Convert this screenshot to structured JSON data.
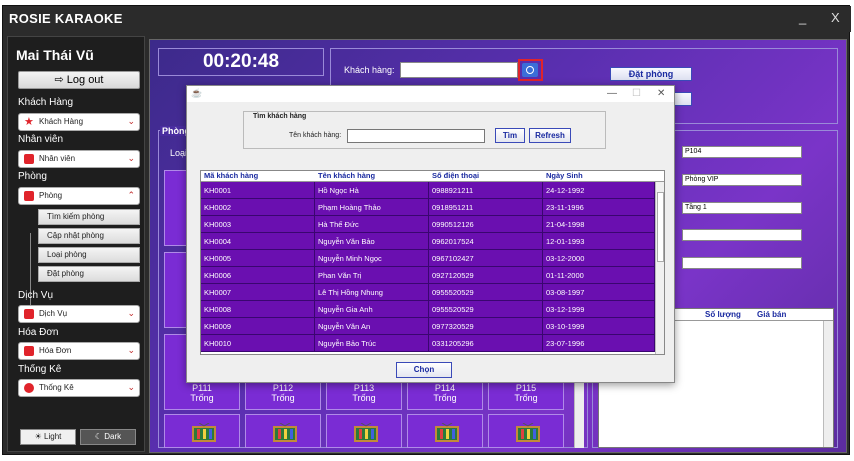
{
  "app": {
    "title": "ROSIE KARAOKE",
    "minimize": "_",
    "close": "X"
  },
  "sidebar": {
    "user_name": "Mai Thái Vũ",
    "logout": "Log out",
    "sections": [
      {
        "label": "Khách Hàng",
        "combo": "Khách Hàng"
      },
      {
        "label": "Nhân viên",
        "combo": "Nhân viên"
      },
      {
        "label": "Phòng",
        "combo": "Phòng"
      },
      {
        "label": "Dịch Vụ",
        "combo": "Dịch Vụ"
      },
      {
        "label": "Hóa Đơn",
        "combo": "Hóa Đơn"
      },
      {
        "label": "Thống Kê",
        "combo": "Thống Kê"
      }
    ],
    "phong_sub": [
      "Tìm kiếm phòng",
      "Cập nhật phòng",
      "Loại phòng",
      "Đặt phòng"
    ],
    "theme_light": "Light",
    "theme_dark": "Dark"
  },
  "main": {
    "clock": "00:20:48",
    "khach_hang_label": "Khách hàng:",
    "dat_phong": "Đặt phòng",
    "phong_label": "Phòng",
    "loai_label": "Loại",
    "room_info": {
      "so_phong": "P104",
      "loai": "Phòng VIP",
      "tang": "Tầng 1"
    },
    "service_headers": {
      "so_luong": "Số lượng",
      "gia_ban": "Giá bán"
    },
    "rooms": [
      {
        "name": "P111",
        "status": "Trống"
      },
      {
        "name": "P112",
        "status": "Trống"
      },
      {
        "name": "P113",
        "status": "Trống"
      },
      {
        "name": "P114",
        "status": "Trống"
      },
      {
        "name": "P115",
        "status": "Trống"
      }
    ]
  },
  "dialog": {
    "group_title": "Tìm khách hàng",
    "name_label": "Tên khách hàng:",
    "search_button": "Tìm",
    "refresh_button": "Refresh",
    "choose_button": "Chọn",
    "columns": [
      "Mã khách hàng",
      "Tên khách hàng",
      "Số điện thoại",
      "Ngày Sinh"
    ],
    "rows": [
      [
        "KH0001",
        "Hồ Ngọc Hà",
        "0988921211",
        "24-12-1992"
      ],
      [
        "KH0002",
        "Phạm Hoàng Thảo",
        "0918951211",
        "23-11-1996"
      ],
      [
        "KH0003",
        "Hà Thế Đức",
        "0990512126",
        "21-04-1998"
      ],
      [
        "KH0004",
        "Nguyễn Văn Bảo",
        "0962017524",
        "12-01-1993"
      ],
      [
        "KH0005",
        "Nguyễn Minh Ngọc",
        "0967102427",
        "03-12-2000"
      ],
      [
        "KH0006",
        "Phan Văn Trị",
        "0927120529",
        "01-11-2000"
      ],
      [
        "KH0007",
        "Lê Thị Hồng Nhung",
        "0955520529",
        "03-08-1997"
      ],
      [
        "KH0008",
        "Nguyễn Gia Anh",
        "0955520529",
        "03-12-1999"
      ],
      [
        "KH0009",
        "Nguyễn Văn An",
        "0977320529",
        "03-10-1999"
      ],
      [
        "KH0010",
        "Nguyễn Bảo Trúc",
        "0331205296",
        "23-07-1996"
      ]
    ]
  }
}
